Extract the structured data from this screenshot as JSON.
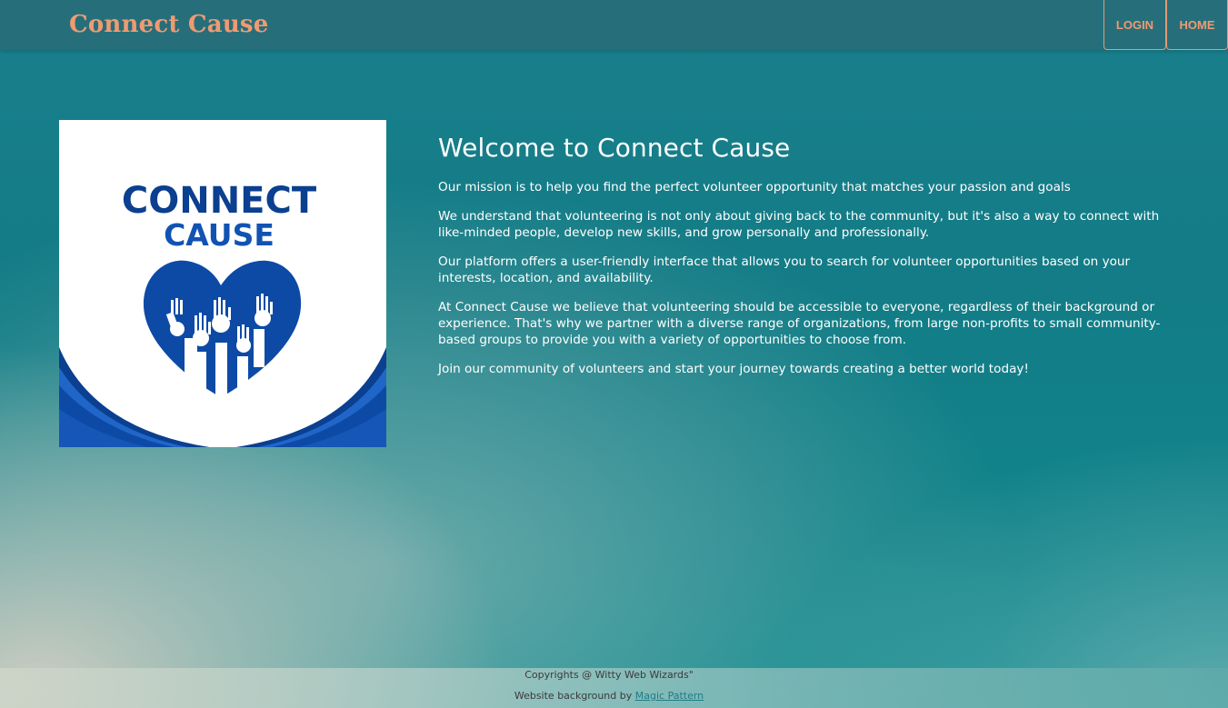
{
  "header": {
    "brand": "Connect Cause",
    "nav": {
      "login_label": "LOGIN",
      "home_label": "HOME"
    }
  },
  "logo": {
    "line1": "CONNECT",
    "line2": "CAUSE"
  },
  "main": {
    "title": "Welcome to Connect Cause",
    "paragraphs": [
      "Our mission is to help you find the perfect volunteer opportunity that matches your passion and goals",
      "We understand that volunteering is not only about giving back to the community, but it's also a way to connect with like-minded people, develop new skills, and grow personally and professionally.",
      "Our platform offers a user-friendly interface that allows you to search for volunteer opportunities based on your interests, location, and availability.",
      "At Connect Cause we believe that volunteering should be accessible to everyone, regardless of their background or experience. That's why we partner with a diverse range of organizations, from large non-profits to small community-based groups to provide you with a variety of opportunities to choose from.",
      "Join our community of volunteers and start your journey towards creating a better world today!"
    ]
  },
  "footer": {
    "copyright": "Copyrights @ Witty Web Wizards\"",
    "credit_prefix": "Website background by",
    "credit_link": "Magic Pattern"
  },
  "colors": {
    "brand_accent": "#f09a72",
    "logo_blue": "#0b3f8f",
    "logo_mid_blue": "#1153b3",
    "header_bg": "#266f7a",
    "page_teal": "#137c86"
  }
}
